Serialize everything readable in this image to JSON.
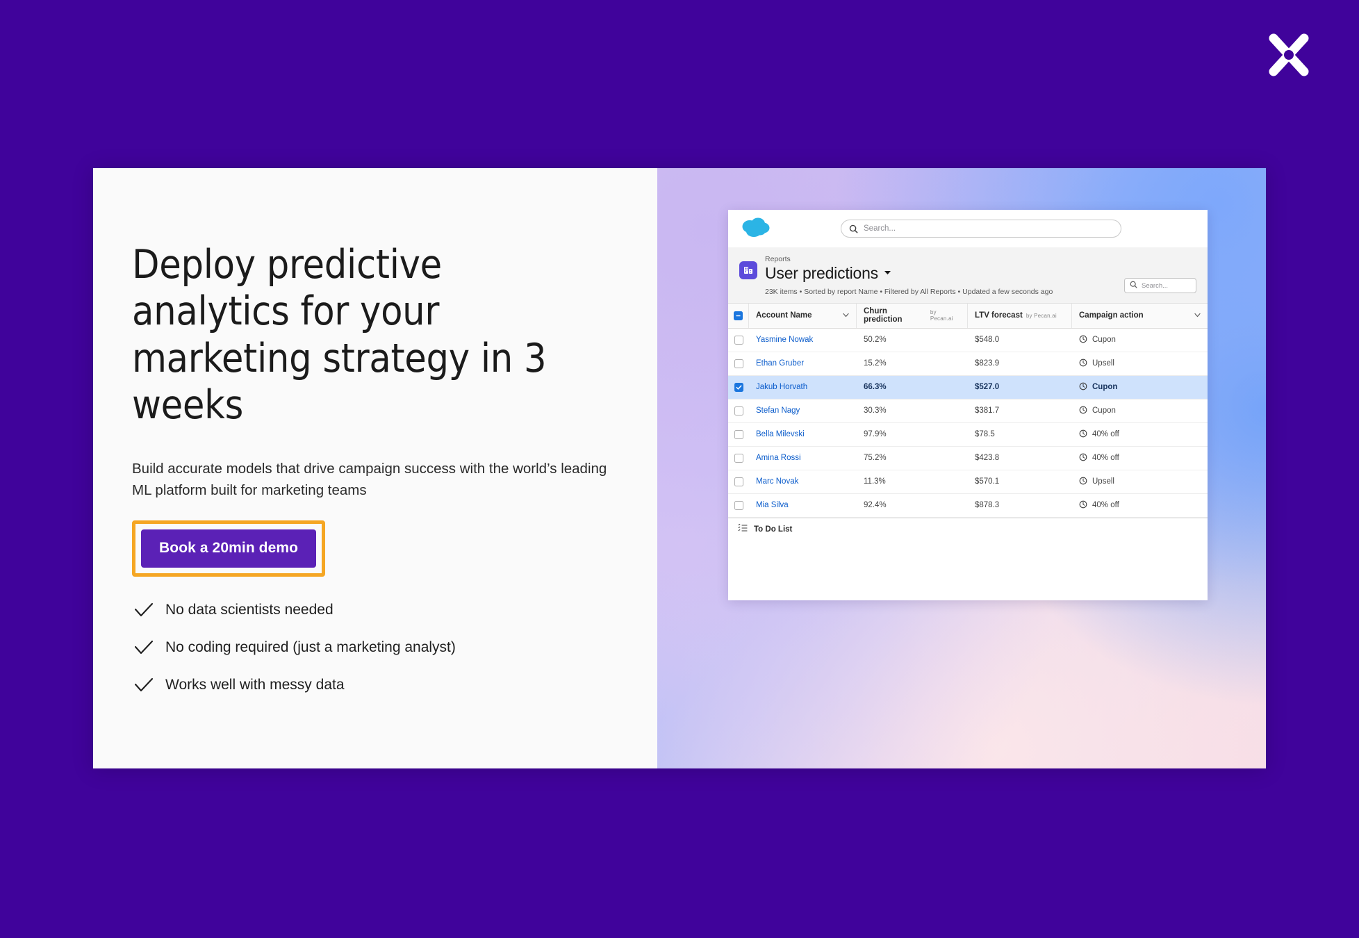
{
  "overlay": {
    "background_color": "#40039B",
    "close_icon": "close-x-icon",
    "close_label": "Close"
  },
  "promo": {
    "headline": "Deploy predictive analytics for your marketing strategy in 3 weeks",
    "subhead": "Build accurate models that drive campaign success with the world’s leading ML platform built for marketing teams",
    "cta_label": "Book a 20min demo",
    "cta_color": "#5B21B6",
    "focus_ring_color": "#F5A623",
    "bullets": [
      {
        "icon": "check-icon",
        "label": "No data scientists needed"
      },
      {
        "icon": "check-icon",
        "label": "No coding required (just a marketing analyst)"
      },
      {
        "icon": "check-icon",
        "label": "Works well with messy data"
      }
    ]
  },
  "app": {
    "logo_icon": "salesforce-cloud-logo",
    "global_search": {
      "icon": "search-icon",
      "placeholder": "Search..."
    },
    "report_icon": "report-icon",
    "kicker": "Reports",
    "title": "User predictions",
    "title_caret_icon": "chevron-down-icon",
    "meta": "23K items • Sorted by report Name • Filtered by All Reports • Updated a few seconds ago",
    "list_search": {
      "icon": "search-icon",
      "placeholder": "Search..."
    },
    "footer": {
      "icon": "todo-list-icon",
      "label": "To Do List"
    },
    "table": {
      "select_all_state": "indeterminate",
      "columns": [
        {
          "label": "Account Name",
          "by": "",
          "caret": true
        },
        {
          "label": "Churn prediction",
          "by": "by Pecan.ai",
          "caret": false
        },
        {
          "label": "LTV forecast",
          "by": "by Pecan.ai",
          "caret": false
        },
        {
          "label": "Campaign action",
          "by": "",
          "caret": true
        }
      ],
      "rows": [
        {
          "selected": false,
          "name": "Yasmine Nowak",
          "churn": "50.2%",
          "ltv": "$548.0",
          "action": "Cupon",
          "action_icon": "campaign-action-icon"
        },
        {
          "selected": false,
          "name": "Ethan Gruber",
          "churn": "15.2%",
          "ltv": "$823.9",
          "action": "Upsell",
          "action_icon": "campaign-action-icon"
        },
        {
          "selected": true,
          "name": "Jakub Horvath",
          "churn": "66.3%",
          "ltv": "$527.0",
          "action": "Cupon",
          "action_icon": "campaign-action-icon"
        },
        {
          "selected": false,
          "name": "Stefan Nagy",
          "churn": "30.3%",
          "ltv": "$381.7",
          "action": "Cupon",
          "action_icon": "campaign-action-icon"
        },
        {
          "selected": false,
          "name": "Bella Milevski",
          "churn": "97.9%",
          "ltv": "$78.5",
          "action": "40% off",
          "action_icon": "campaign-action-icon"
        },
        {
          "selected": false,
          "name": "Amina Rossi",
          "churn": "75.2%",
          "ltv": "$423.8",
          "action": "40% off",
          "action_icon": "campaign-action-icon"
        },
        {
          "selected": false,
          "name": "Marc Novak",
          "churn": "11.3%",
          "ltv": "$570.1",
          "action": "Upsell",
          "action_icon": "campaign-action-icon"
        },
        {
          "selected": false,
          "name": "Mia Silva",
          "churn": "92.4%",
          "ltv": "$878.3",
          "action": "40% off",
          "action_icon": "campaign-action-icon"
        }
      ]
    }
  }
}
